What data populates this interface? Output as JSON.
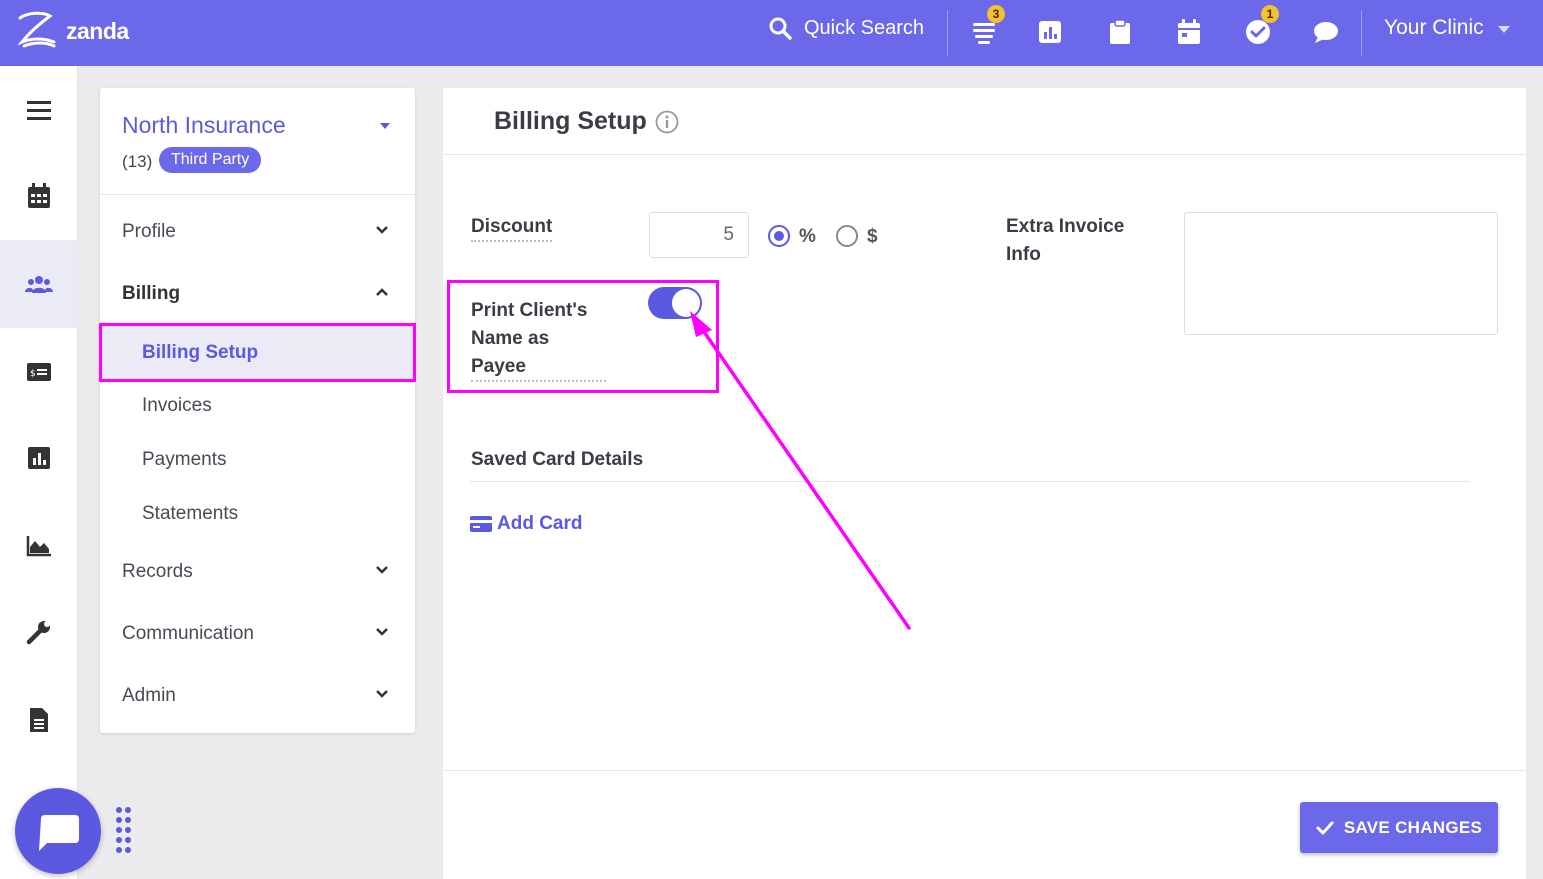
{
  "app": {
    "logo_text": "zanda"
  },
  "topbar": {
    "search_label": "Quick Search",
    "tasks_badge": "3",
    "todos_badge": "1",
    "clinic_name": "Your Clinic"
  },
  "client": {
    "name": "North Insurance",
    "count": "(13)",
    "tag": "Third Party"
  },
  "nav": {
    "profile": "Profile",
    "billing": "Billing",
    "billing_setup": "Billing Setup",
    "invoices": "Invoices",
    "payments": "Payments",
    "statements": "Statements",
    "records": "Records",
    "communication": "Communication",
    "admin": "Admin"
  },
  "main": {
    "title": "Billing Setup",
    "discount_label": "Discount",
    "discount_value": "5",
    "percent_label": "%",
    "dollar_label": "$",
    "print_payee_label_1": "Print Client's",
    "print_payee_label_2": "Name as",
    "print_payee_label_3": "Payee",
    "print_payee_enabled": true,
    "extra_invoice_label_1": "Extra Invoice",
    "extra_invoice_label_2": "Info",
    "extra_invoice_value": "",
    "saved_card_title": "Saved Card Details",
    "add_card_label": "Add Card"
  },
  "footer": {
    "save_label": "SAVE CHANGES"
  },
  "colors": {
    "brand": "#6b69ea",
    "accent": "#5b59e0",
    "annotation": "#ff00ff",
    "badge": "#f3c12b"
  }
}
